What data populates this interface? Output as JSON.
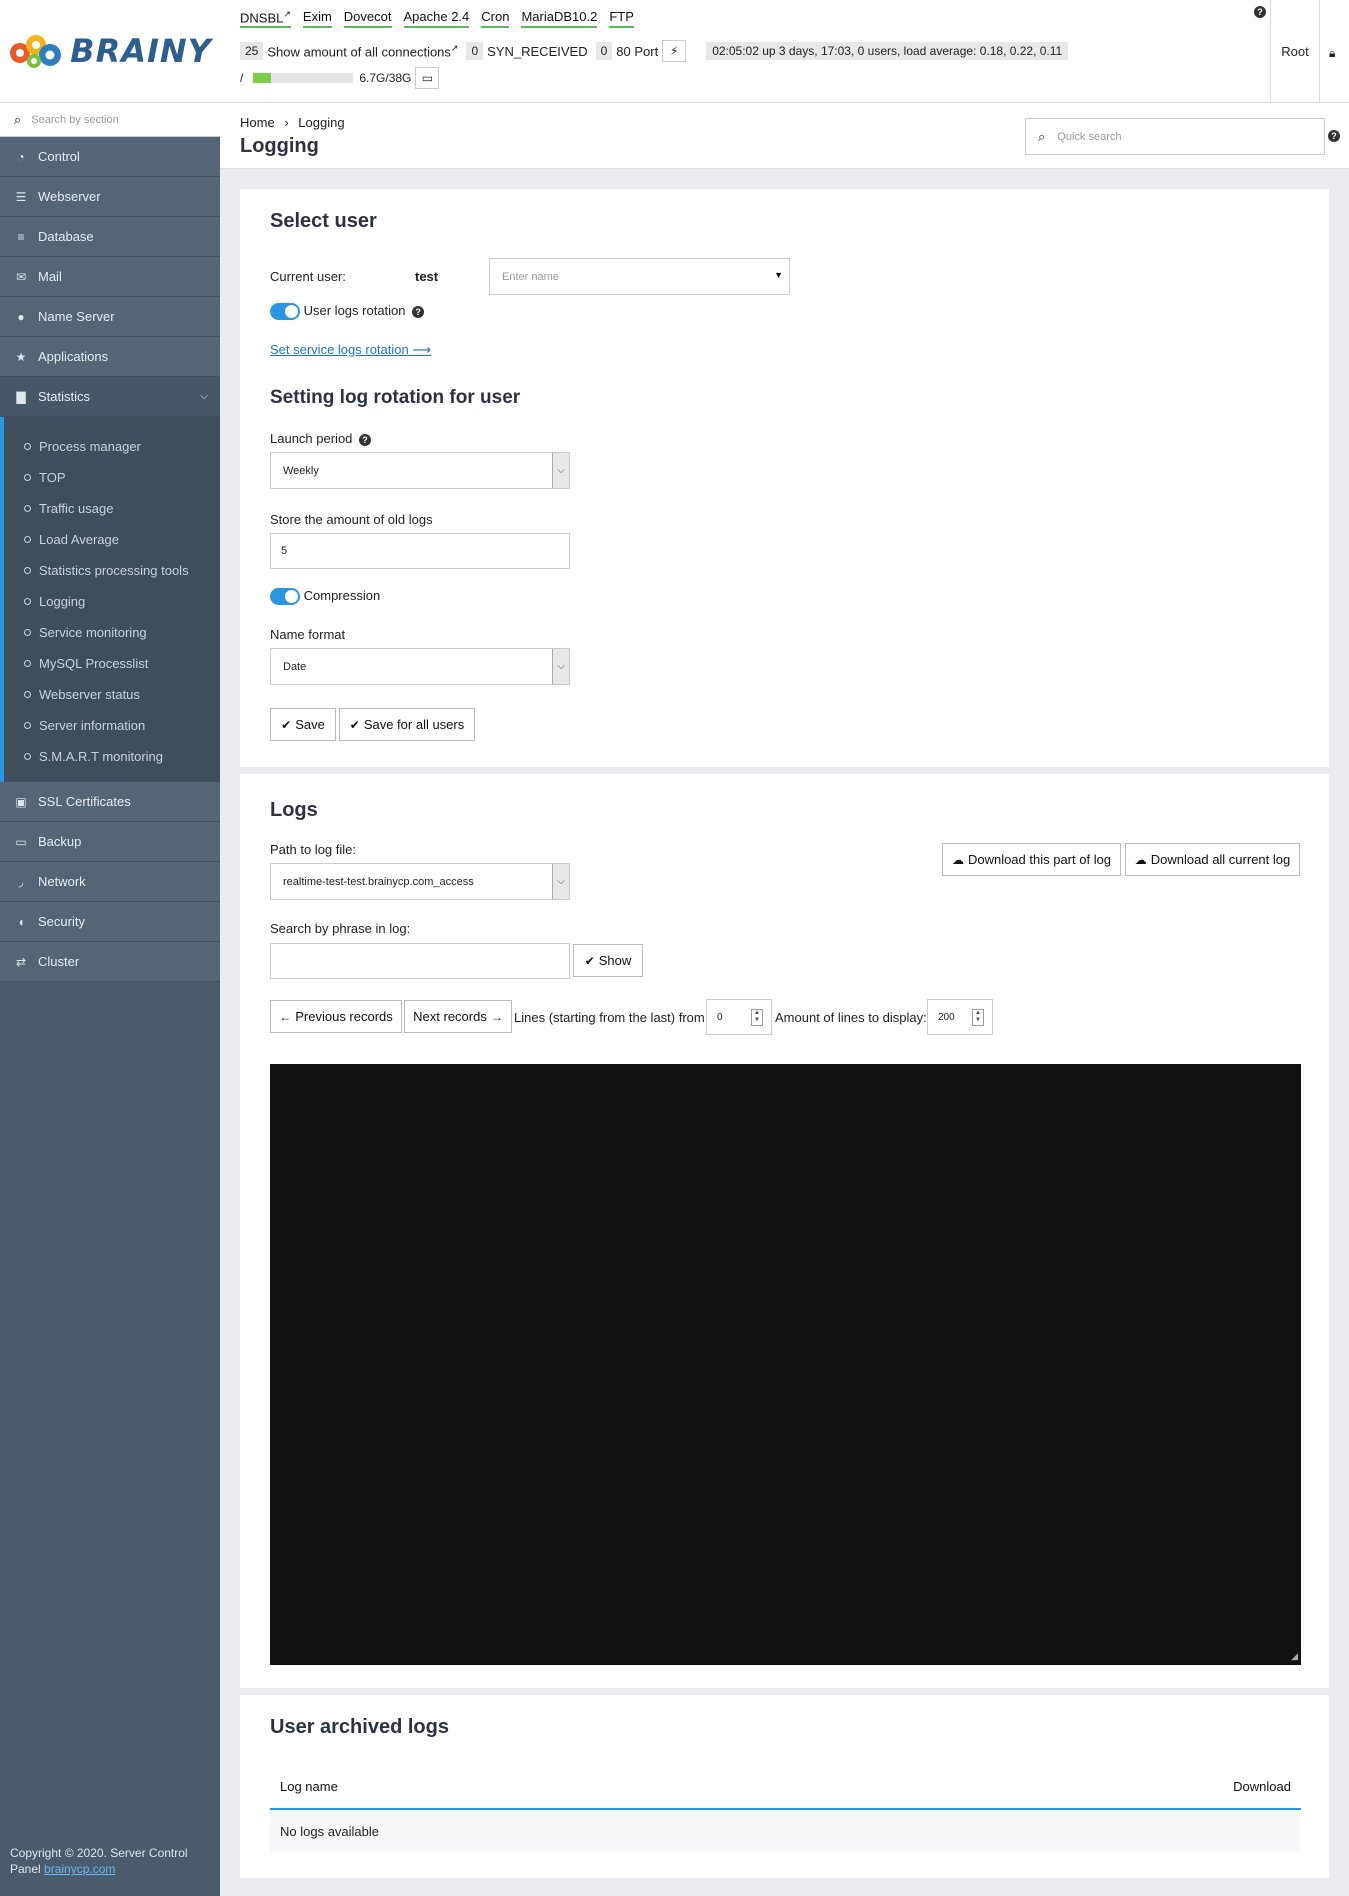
{
  "brand": {
    "logo_text": "BRAINY"
  },
  "sidebar": {
    "search_placeholder": "Search by section",
    "items": [
      {
        "label": "Control",
        "icon": "dashboard-icon"
      },
      {
        "label": "Webserver",
        "icon": "server-icon"
      },
      {
        "label": "Database",
        "icon": "database-icon"
      },
      {
        "label": "Mail",
        "icon": "envelope-icon"
      },
      {
        "label": "Name Server",
        "icon": "globe-icon"
      },
      {
        "label": "Applications",
        "icon": "star-icon"
      },
      {
        "label": "Statistics",
        "icon": "bar-chart-icon"
      }
    ],
    "statistics_sub": [
      "Process manager",
      "TOP",
      "Traffic usage",
      "Load Average",
      "Statistics processing tools",
      "Logging",
      "Service monitoring",
      "MySQL Processlist",
      "Webserver status",
      "Server information",
      "S.M.A.R.T monitoring"
    ],
    "items_after": [
      {
        "label": "SSL Certificates",
        "icon": "lock-icon"
      },
      {
        "label": "Backup",
        "icon": "hdd-icon"
      },
      {
        "label": "Network",
        "icon": "rss-icon"
      },
      {
        "label": "Security",
        "icon": "shield-icon"
      },
      {
        "label": "Cluster",
        "icon": "exchange-icon"
      }
    ],
    "copyright_text": "Copyright © 2020. Server Control Panel",
    "copyright_link": "brainycp.com"
  },
  "header": {
    "services": [
      "DNSBL",
      "Exim",
      "Dovecot",
      "Apache 2.4",
      "Cron",
      "MariaDB10.2",
      "FTP"
    ],
    "connections_count": "25",
    "connections_label": "Show amount of all connections",
    "syn_count": "0",
    "syn_label": "SYN_RECEIVED",
    "port_count": "0",
    "port_label": "80 Port",
    "uptime": "02:05:02 up 3 days, 17:03, 0 users, load average: 0.18, 0.22, 0.11",
    "disk_mount": "/",
    "disk_usage": "6.7G/38G",
    "disk_fill_fraction": 0.18,
    "user": "Root"
  },
  "page": {
    "breadcrumb_home": "Home",
    "breadcrumb_sep": "›",
    "breadcrumb_current": "Logging",
    "title": "Logging",
    "quick_search_placeholder": "Quick search"
  },
  "select_user": {
    "heading": "Select user",
    "current_user_label": "Current user:",
    "current_user_value": "test",
    "name_placeholder": "Enter name",
    "rotation_label": "User logs rotation",
    "service_link": "Set service logs rotation ⟶",
    "rotation_heading": "Setting log rotation for user",
    "launch_period_label": "Launch period",
    "launch_period_value": "Weekly",
    "store_label": "Store the amount of old logs",
    "store_value": "5",
    "compression_label": "Compression",
    "name_format_label": "Name format",
    "name_format_value": "Date",
    "save_label": "Save",
    "save_all_label": "Save for all users"
  },
  "logs": {
    "heading": "Logs",
    "path_label": "Path to log file:",
    "path_value": "realtime-test-test.brainycp.com_access",
    "download_part": "Download this part of log",
    "download_all": "Download all current log",
    "search_label": "Search by phrase in log:",
    "show_label": "Show",
    "prev_label": "Previous records",
    "next_label": "Next records",
    "lines_from_label": "Lines (starting from the last) from",
    "lines_from_value": "0",
    "amount_label": "Amount of lines to display:",
    "amount_value": "200"
  },
  "archived": {
    "heading": "User archived logs",
    "col_name": "Log name",
    "col_download": "Download",
    "empty": "No logs available"
  },
  "colors": {
    "accent": "#2b95e0",
    "sidebar": "#4a5b6b",
    "service_ok": "#5cb85c"
  }
}
